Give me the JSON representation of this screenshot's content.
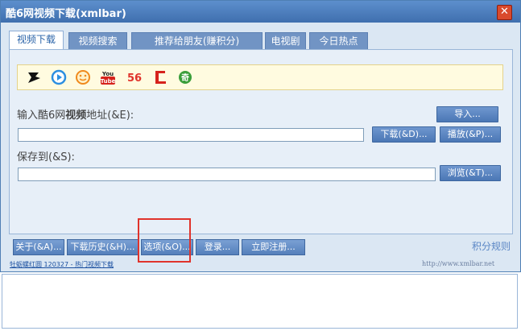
{
  "window": {
    "title": "酷6网视频下载(xmlbar)"
  },
  "tabs": [
    {
      "label": "视频下载"
    },
    {
      "label": "视频搜索"
    },
    {
      "label": "推荐给朋友(赚积分)"
    },
    {
      "label": "电视剧"
    },
    {
      "label": "今日热点"
    }
  ],
  "sites": [
    "6",
    "play",
    "smile",
    "You Tube",
    "56",
    "E",
    "qi"
  ],
  "input": {
    "label_prefix": "输入酷6网",
    "label_bold": "视频",
    "label_suffix": "地址(&E):",
    "value": ""
  },
  "save": {
    "label": "保存到(&S):",
    "value": ""
  },
  "buttons": {
    "import": "导入...",
    "download": "下载(&D)...",
    "play": "播放(&P)...",
    "browse": "浏览(&T)..."
  },
  "bottom": {
    "about": "关于(&A)...",
    "history": "下载历史(&H)...",
    "options": "选项(&O)...",
    "login": "登录...",
    "register": "立即注册...",
    "credit_rules": "积分规则"
  },
  "footer": {
    "link": "牡蛎螺红圆 120327 - 热门视频下载",
    "url": "http://www.xmlbar.net"
  },
  "colors": {
    "accent": "#4b77b5",
    "highlight": "#e0332b"
  }
}
